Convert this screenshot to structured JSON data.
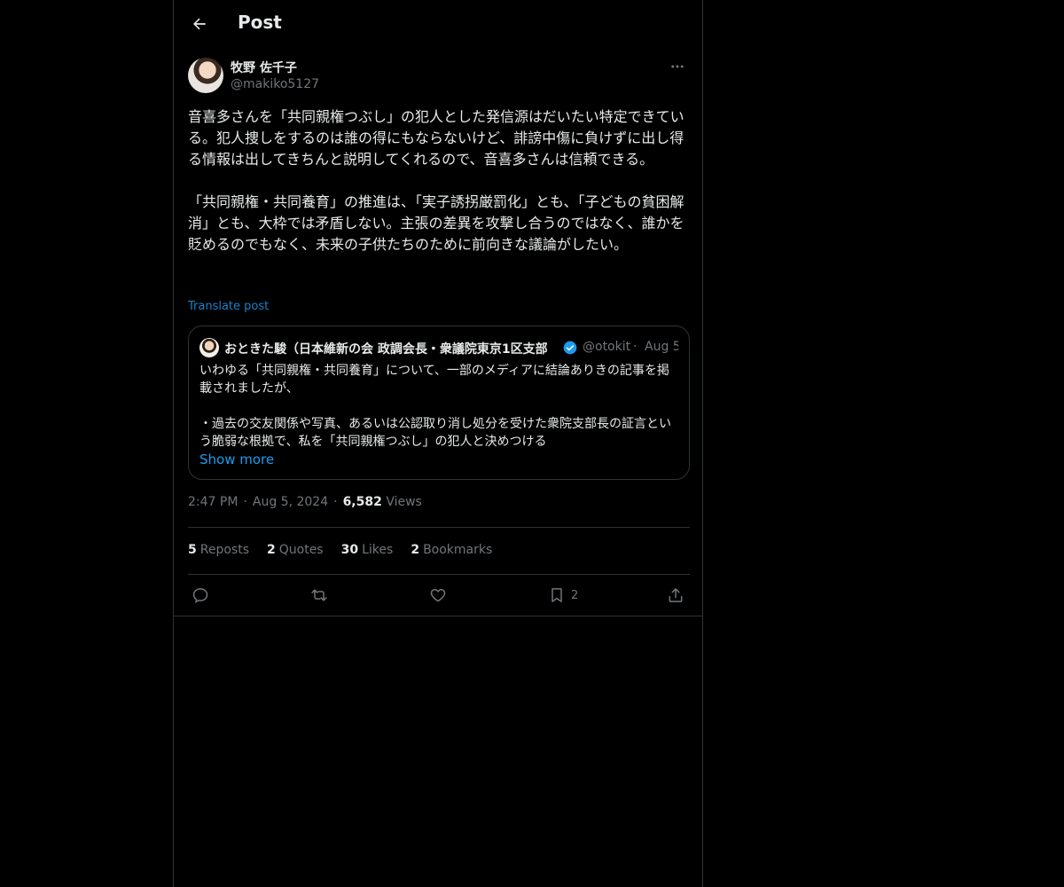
{
  "header": {
    "title": "Post"
  },
  "post": {
    "author_name": "牧野 佐千子",
    "author_handle": "@makiko5127",
    "text": "音喜多さんを「共同親権つぶし」の犯人とした発信源はだいたい特定できている。犯人捜しをするのは誰の得にもならないけど、誹謗中傷に負けずに出し得る情報は出してきちんと説明してくれるので、音喜多さんは信頼できる。\n\n「共同親権・共同養育」の推進は、「実子誘拐厳罰化」とも、「子どもの貧困解消」とも、大枠では矛盾しない。主張の差異を攻撃し合うのではなく、誰かを貶めるのでもなく、未来の子供たちのために前向きな議論がしたい。",
    "translate_label": "Translate post"
  },
  "quote": {
    "name": "おときた駿（日本維新の会 政調会長・衆議院東京1区支部",
    "handle": "@otokit",
    "separator": "·",
    "date": "Aug 5",
    "text": "いわゆる「共同親権・共同養育」について、一部のメディアに結論ありきの記事を掲載されましたが、\n\n・過去の交友関係や写真、あるいは公認取り消し処分を受けた衆院支部長の証言という脆弱な根拠で、私を「共同親権つぶし」の犯人と決めつける",
    "show_more_label": "Show more"
  },
  "meta": {
    "time": "2:47 PM",
    "date": "Aug 5, 2024",
    "separator": "·",
    "views_count": "6,582",
    "views_label": "Views"
  },
  "stats": {
    "reposts_count": "5",
    "reposts_label": "Reposts",
    "quotes_count": "2",
    "quotes_label": "Quotes",
    "likes_count": "30",
    "likes_label": "Likes",
    "bookmarks_count": "2",
    "bookmarks_label": "Bookmarks"
  },
  "actions": {
    "reply_icon": "reply-icon",
    "repost_icon": "repost-icon",
    "like_icon": "heart-icon",
    "bookmark_icon": "bookmark-icon",
    "bookmark_count": "2",
    "share_icon": "share-icon"
  },
  "colors": {
    "background": "#000000",
    "text": "#e7e9ea",
    "secondary_text": "#71767b",
    "accent": "#1d9bf0",
    "border": "#2f3336"
  }
}
